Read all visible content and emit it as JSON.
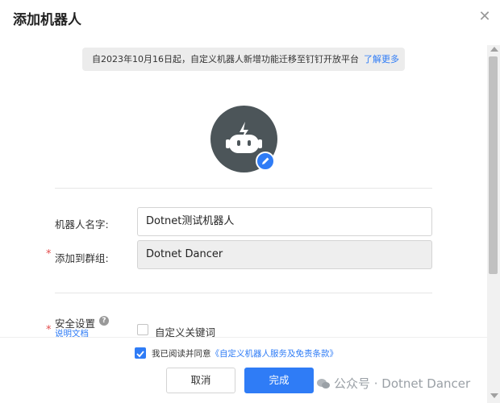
{
  "dialog": {
    "title": "添加机器人",
    "close_icon": "close-icon"
  },
  "notice": {
    "text": "自2023年10月16日起，自定义机器人新增功能迁移至钉钉开放平台",
    "link": "了解更多"
  },
  "avatar": {
    "icon": "robot-icon",
    "edit_icon": "pencil-icon"
  },
  "form": {
    "name_label": "机器人名字:",
    "name_value": "Dotnet测试机器人",
    "group_required": "*",
    "group_label": "添加到群组:",
    "group_value": "Dotnet Dancer",
    "security_required": "*",
    "security_label": "安全设置",
    "security_help_icon": "question-icon",
    "security_doc_link": "说明文档",
    "keyword_label": "自定义关键词",
    "keyword_checked": false
  },
  "footer": {
    "agree_checked": true,
    "agree_text": "我已阅读并同意",
    "agree_link": "《自定义机器人服务及免责条款》",
    "cancel_label": "取消",
    "ok_label": "完成"
  },
  "watermark": {
    "text": "公众号 · Dotnet Dancer"
  },
  "colors": {
    "accent": "#2f7cf6",
    "required": "#e34d4d",
    "avatar_bg": "#4c5559"
  }
}
